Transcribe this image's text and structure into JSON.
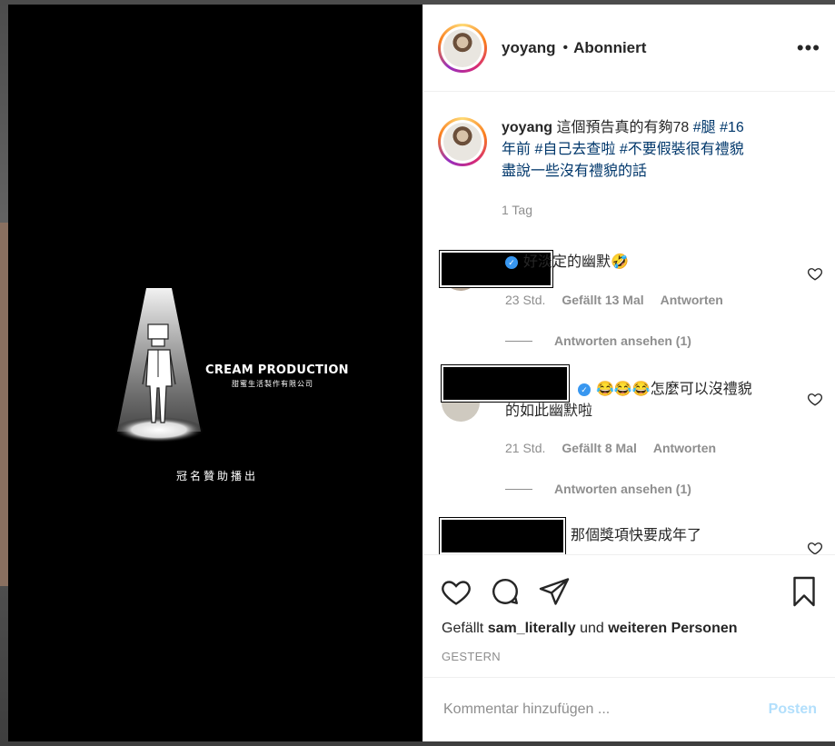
{
  "header": {
    "username": "yoyang",
    "separator": "•",
    "follow_state": "Abonniert",
    "more_icon": "more-horizontal-icon"
  },
  "video": {
    "logo_title": "CREAM PRODUCTION",
    "logo_subtitle": "甜蜜生活製作有限公司",
    "sponsor_text": "冠名贊助播出"
  },
  "caption": {
    "username": "yoyang",
    "text_plain": " 這個預告真的有夠78 ",
    "tag_leg": "#腿",
    "tag_16_a": " #16",
    "text_line2_start": "年前",
    "tag_self": " #自己去查啦",
    "tag_pretend": " #不要假裝很有禮貌",
    "line3": "盡說一些沒有禮貌的話",
    "time": "1 Tag"
  },
  "comments": [
    {
      "text": "好淡定的幽默🤣",
      "time": "23 Std.",
      "likes": "Gefällt 13 Mal",
      "reply": "Antworten",
      "view_replies": "Antworten ansehen (1)"
    },
    {
      "text": "😂😂😂怎麼可以沒禮貌的如此幽默啦",
      "time": "21 Std.",
      "likes": "Gefällt 8 Mal",
      "reply": "Antworten",
      "view_replies": "Antworten ansehen (1)"
    },
    {
      "text": "那個獎項快要成年了"
    }
  ],
  "actions": {
    "like_icon": "heart-icon",
    "comment_icon": "comment-icon",
    "share_icon": "share-icon",
    "save_icon": "bookmark-icon",
    "likes_prefix": "Gefällt ",
    "likes_user": "sam_literally",
    "likes_middle": " und ",
    "likes_suffix": "weiteren Personen",
    "date": "GESTERN"
  },
  "add_comment": {
    "placeholder": "Kommentar hinzufügen ...",
    "post_label": "Posten"
  },
  "colors": {
    "hashtag": "#00376b",
    "verified": "#3897f0",
    "post_disabled": "#b2dffc",
    "muted": "#8e8e8e"
  }
}
